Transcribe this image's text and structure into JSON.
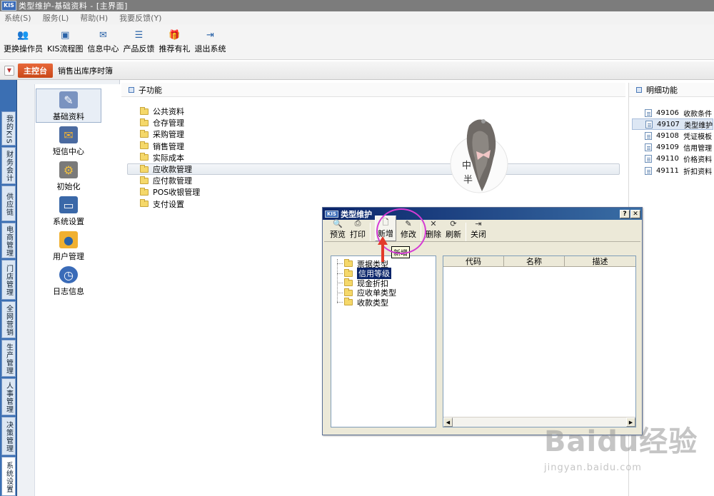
{
  "window": {
    "kis_badge": "KIS",
    "title": "类型维护-基础资料 - [主界面]"
  },
  "menu": [
    "系统(S)",
    "服务(L)",
    "帮助(H)",
    "我要反馈(Y)"
  ],
  "toolbar": [
    {
      "label": "更换操作员",
      "icon": "user-switch-icon"
    },
    {
      "label": "KIS流程图",
      "icon": "flowchart-icon"
    },
    {
      "label": "信息中心",
      "icon": "message-icon"
    },
    {
      "label": "产品反馈",
      "icon": "feedback-icon"
    },
    {
      "label": "推荐有礼",
      "icon": "gift-icon"
    },
    {
      "label": "退出系统",
      "icon": "exit-icon"
    }
  ],
  "nav": {
    "main": "主控台",
    "crumb": "销售出库序时簿"
  },
  "vtabs": [
    "我的KIS",
    "财务会计",
    "供应链",
    "电商管理",
    "门店管理",
    "全网营销",
    "生产管理",
    "人事管理",
    "决策管理",
    "系统设置"
  ],
  "modules": [
    "基础资料",
    "短信中心",
    "初始化",
    "系统设置",
    "用户管理",
    "日志信息"
  ],
  "sub": {
    "title": "子功能",
    "folders": [
      "公共资料",
      "仓存管理",
      "采购管理",
      "销售管理",
      "实际成本",
      "应收款管理",
      "应付款管理",
      "POS收银管理",
      "支付设置"
    ],
    "selected_index": 5
  },
  "avatar": {
    "text1": "中",
    "text2": "半"
  },
  "detail": {
    "title": "明细功能",
    "items": [
      {
        "code": "49106",
        "name": "收款条件"
      },
      {
        "code": "49107",
        "name": "类型维护"
      },
      {
        "code": "49108",
        "name": "凭证模板"
      },
      {
        "code": "49109",
        "name": "信用管理"
      },
      {
        "code": "49110",
        "name": "价格资料"
      },
      {
        "code": "49111",
        "name": "折扣资料"
      }
    ],
    "selected_index": 1
  },
  "dialog": {
    "kis_badge": "KIS",
    "title": "类型维护",
    "help": "?",
    "close": "✕",
    "buttons": [
      "预览",
      "打印",
      "新增",
      "修改",
      "删除",
      "刷新",
      "关闭"
    ],
    "tooltip": "新增",
    "tree": [
      "票据类型",
      "信用等级",
      "现金折扣",
      "应收单类型",
      "收款类型"
    ],
    "tree_selected_index": 1,
    "columns": [
      "代码",
      "名称",
      "描述"
    ]
  },
  "watermark": {
    "big": "Baidu经验",
    "small": "jingyan.baidu.com"
  }
}
